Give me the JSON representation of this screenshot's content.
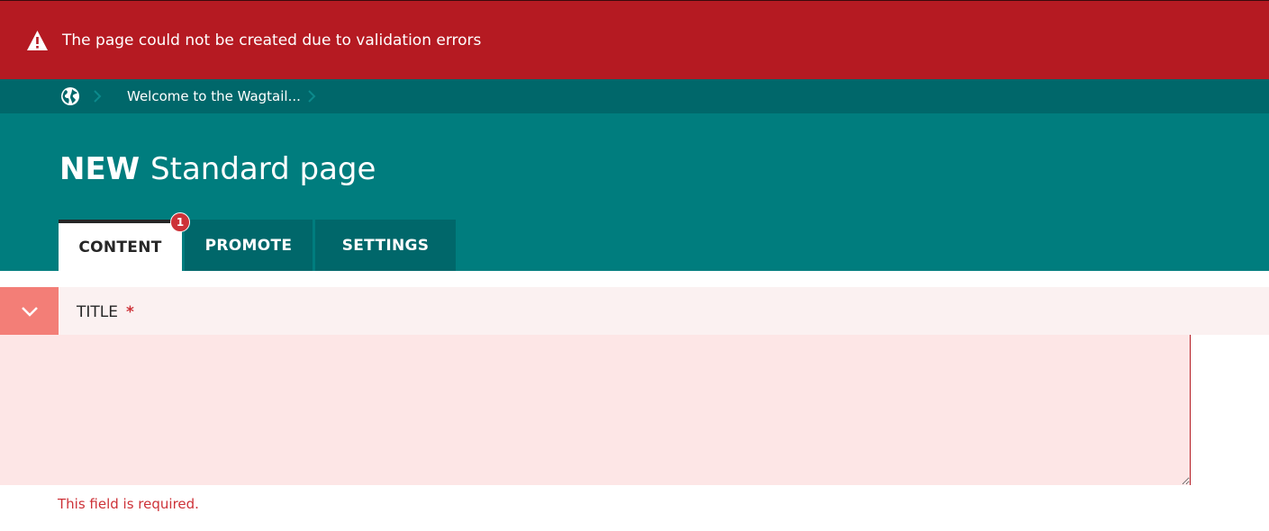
{
  "error_banner": {
    "message": "The page could not be created due to validation errors",
    "icon": "warning-icon"
  },
  "breadcrumb": {
    "root_icon": "globe-icon",
    "items": [
      "Welcome to the Wagtail..."
    ]
  },
  "header": {
    "title_prefix": "NEW",
    "title_type": "Standard page"
  },
  "tabs": [
    {
      "label": "CONTENT",
      "active": true,
      "error_count": "1"
    },
    {
      "label": "PROMOTE",
      "active": false
    },
    {
      "label": "SETTINGS",
      "active": false
    }
  ],
  "title_field": {
    "label": "TITLE",
    "required_marker": "*",
    "value": "",
    "error": "This field is required."
  },
  "colors": {
    "error_banner": "#b51a22",
    "breadcrumb_bg": "#00676a",
    "header_bg": "#007d7e",
    "field_error_bg": "#fde6e6",
    "toggle_bg": "#f37e77",
    "error_text": "#cd3238"
  }
}
